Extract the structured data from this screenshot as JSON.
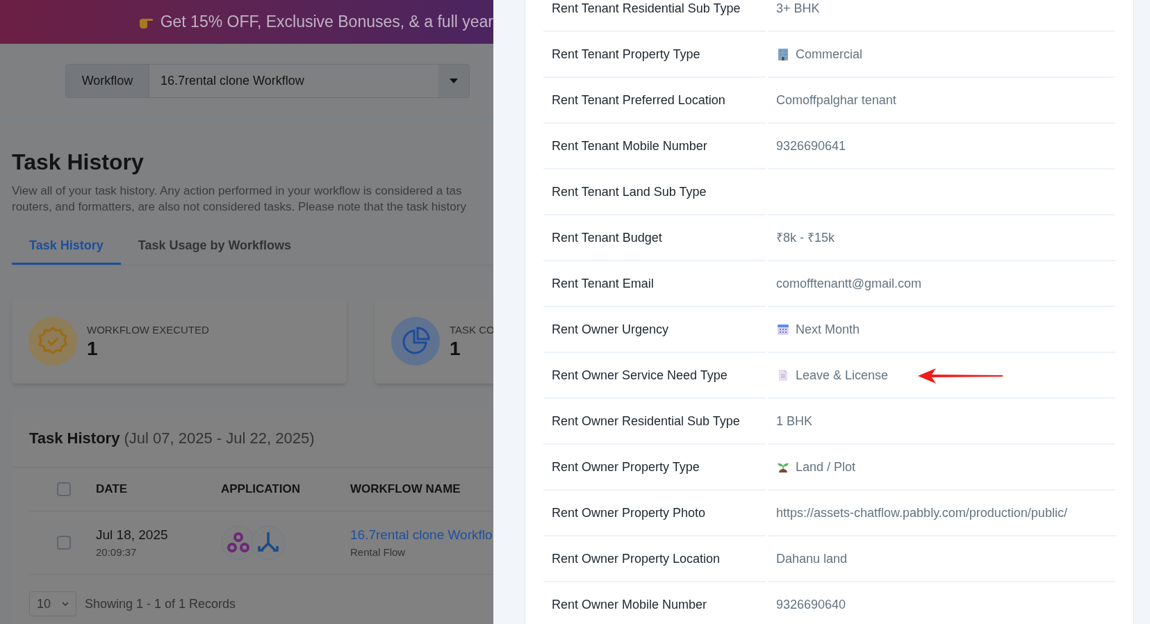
{
  "promo_banner": {
    "text": "Get 15% OFF, Exclusive Bonuses, & a full year"
  },
  "workflow_select": {
    "label": "Workflow",
    "value": "16.7rental clone Workflow"
  },
  "page": {
    "title": "Task History",
    "description": [
      "View all of your task history. Any action performed in your workflow is considered a tas",
      "routers, and formatters, are also not considered tasks. Please note that the task history"
    ]
  },
  "tabs": [
    {
      "label": "Task History",
      "selected": true
    },
    {
      "label": "Task Usage by Workflows",
      "selected": false
    }
  ],
  "stats": [
    {
      "kind": "executed",
      "label": "WORKFLOW EXECUTED",
      "value": "1"
    },
    {
      "kind": "tasks",
      "label": "TASK CO",
      "value": "1"
    }
  ],
  "task_table": {
    "title": "Task History",
    "date_range": "(Jul 07, 2025 - Jul 22, 2025)",
    "columns": [
      "DATE",
      "APPLICATION",
      "WORKFLOW NAME"
    ],
    "header_checked": false,
    "rows": [
      {
        "checked": false,
        "date": "Jul 18, 2025",
        "time": "20:09:37",
        "workflow_name": "16.7rental clone Workflo",
        "workflow_folder": "Rental Flow"
      }
    ],
    "pagination": {
      "page_size": "10",
      "summary": "Showing 1 - 1 of 1 Records"
    }
  },
  "details": [
    {
      "label": "Rent Tenant Residential Sub Type",
      "value": "3+ BHK",
      "kind": "text"
    },
    {
      "label": "Rent Tenant Property Type",
      "value": "Commercial",
      "kind": "building"
    },
    {
      "label": "Rent Tenant Preferred Location",
      "value": "Comoffpalghar tenant",
      "kind": "text"
    },
    {
      "label": "Rent Tenant Mobile Number",
      "value": "9326690641",
      "kind": "text"
    },
    {
      "label": "Rent Tenant Land Sub Type",
      "kind": "text"
    },
    {
      "label": "Rent Tenant Budget",
      "value": "₹8k - ₹15k",
      "kind": "text"
    },
    {
      "label": "Rent Tenant Email",
      "value": "comofftenantt@gmail.com",
      "kind": "text"
    },
    {
      "label": "Rent Owner Urgency",
      "value": "Next Month",
      "kind": "calendar"
    },
    {
      "label": "Rent Owner Service Need Type",
      "value": "Leave & License",
      "kind": "document"
    },
    {
      "label": "Rent Owner Residential Sub Type",
      "value": "1 BHK",
      "kind": "text"
    },
    {
      "label": "Rent Owner Property Type",
      "value": "Land / Plot",
      "kind": "seedling"
    },
    {
      "label": "Rent Owner Property Photo",
      "value": "https://assets-chatflow.pabbly.com/production/public/",
      "kind": "text"
    },
    {
      "label": "Rent Owner Property Location",
      "value": "Dahanu land",
      "kind": "text"
    },
    {
      "label": "Rent Owner Mobile Number",
      "value": "9326690640",
      "kind": "text"
    }
  ]
}
